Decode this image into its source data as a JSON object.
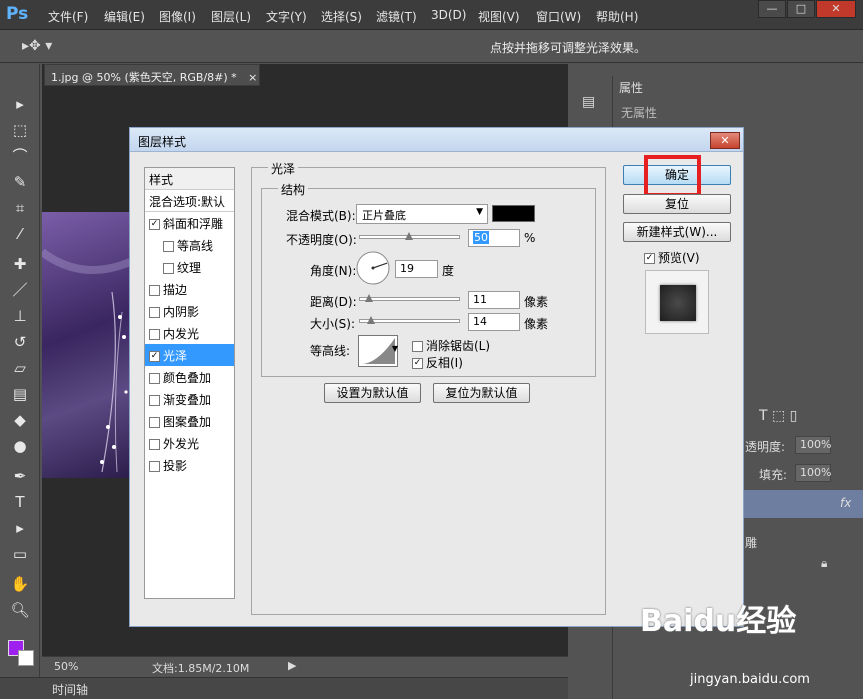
{
  "app": {
    "logo": "Ps",
    "menu": [
      "文件(F)",
      "编辑(E)",
      "图像(I)",
      "图层(L)",
      "文字(Y)",
      "选择(S)",
      "滤镜(T)",
      "3D(D)",
      "视图(V)",
      "窗口(W)",
      "帮助(H)"
    ],
    "window_controls": [
      "—",
      "□",
      "✕"
    ]
  },
  "options_bar": {
    "hint": "点按并拖移可调整光泽效果。"
  },
  "document": {
    "tab_title": "1.jpg @ 50% (紫色天空, RGB/8#) *",
    "tab_close": "×",
    "zoom": "50%",
    "doc_info": "文档:1.85M/2.10M",
    "timeline": "时间轴"
  },
  "properties_panel": {
    "tab": "属性",
    "empty_text": "无属性"
  },
  "layers_panel": {
    "opacity_label": "透明度:",
    "opacity_value": "100%",
    "fill_label": "填充:",
    "fill_value": "100%",
    "fx": "fx",
    "layer_name_fragment": "雕"
  },
  "dialog": {
    "title": "图层样式",
    "close": "✕",
    "style_header": "样式",
    "blend_options": "混合选项:默认",
    "styles": [
      {
        "label": "斜面和浮雕",
        "checked": true,
        "indent": false,
        "selected": false
      },
      {
        "label": "等高线",
        "checked": false,
        "indent": true,
        "selected": false
      },
      {
        "label": "纹理",
        "checked": false,
        "indent": true,
        "selected": false
      },
      {
        "label": "描边",
        "checked": false,
        "indent": false,
        "selected": false
      },
      {
        "label": "内阴影",
        "checked": false,
        "indent": false,
        "selected": false
      },
      {
        "label": "内发光",
        "checked": false,
        "indent": false,
        "selected": false
      },
      {
        "label": "光泽",
        "checked": true,
        "indent": false,
        "selected": true
      },
      {
        "label": "颜色叠加",
        "checked": false,
        "indent": false,
        "selected": false
      },
      {
        "label": "渐变叠加",
        "checked": false,
        "indent": false,
        "selected": false
      },
      {
        "label": "图案叠加",
        "checked": false,
        "indent": false,
        "selected": false
      },
      {
        "label": "外发光",
        "checked": false,
        "indent": false,
        "selected": false
      },
      {
        "label": "投影",
        "checked": false,
        "indent": false,
        "selected": false
      }
    ],
    "group_title": "光泽",
    "structure_title": "结构",
    "blend_mode_label": "混合模式(B):",
    "blend_mode_value": "正片叠底",
    "blend_color": "#000000",
    "opacity_label": "不透明度(O):",
    "opacity_value": "50",
    "opacity_unit": "%",
    "angle_label": "角度(N):",
    "angle_value": "19",
    "angle_unit": "度",
    "distance_label": "距离(D):",
    "distance_value": "11",
    "distance_unit": "像素",
    "size_label": "大小(S):",
    "size_value": "14",
    "size_unit": "像素",
    "contour_label": "等高线:",
    "antialias_label": "消除锯齿(L)",
    "antialias_checked": false,
    "invert_label": "反相(I)",
    "invert_checked": true,
    "set_default": "设置为默认值",
    "reset_default": "复位为默认值",
    "ok": "确定",
    "reset": "复位",
    "new_style": "新建样式(W)...",
    "preview_label": "预览(V)",
    "preview_checked": true
  },
  "watermark": {
    "brand": "Baidu经验",
    "url": "jingyan.baidu.com"
  },
  "colors": {
    "accent": "#3399ff",
    "highlight_box": "#e62020",
    "foreground_swatch": "#a020f0",
    "background_swatch": "#ffffff"
  }
}
